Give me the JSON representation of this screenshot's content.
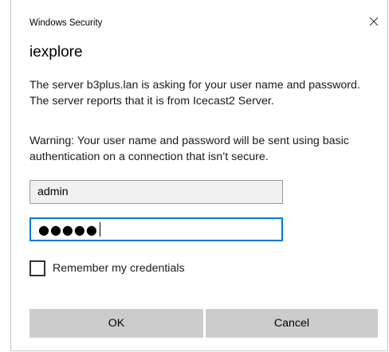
{
  "window": {
    "header_title": "Windows Security",
    "app_title": "iexplore",
    "close_icon": "close-icon"
  },
  "message": {
    "paragraph1": "The server b3plus.lan is asking for your user name and password. The server reports that it is from Icecast2 Server.",
    "paragraph2": "Warning: Your user name and password will be sent using basic authentication on a connection that isn’t secure."
  },
  "form": {
    "username_value": "admin",
    "password_masked": "●●●●●",
    "password_length": 5,
    "remember_label": "Remember my credentials",
    "remember_checked": false
  },
  "buttons": {
    "ok_label": "OK",
    "cancel_label": "Cancel"
  },
  "colors": {
    "focus_border": "#0078d7",
    "button_bg": "#cccccc",
    "readonly_field_bg": "#f0f0f0"
  }
}
